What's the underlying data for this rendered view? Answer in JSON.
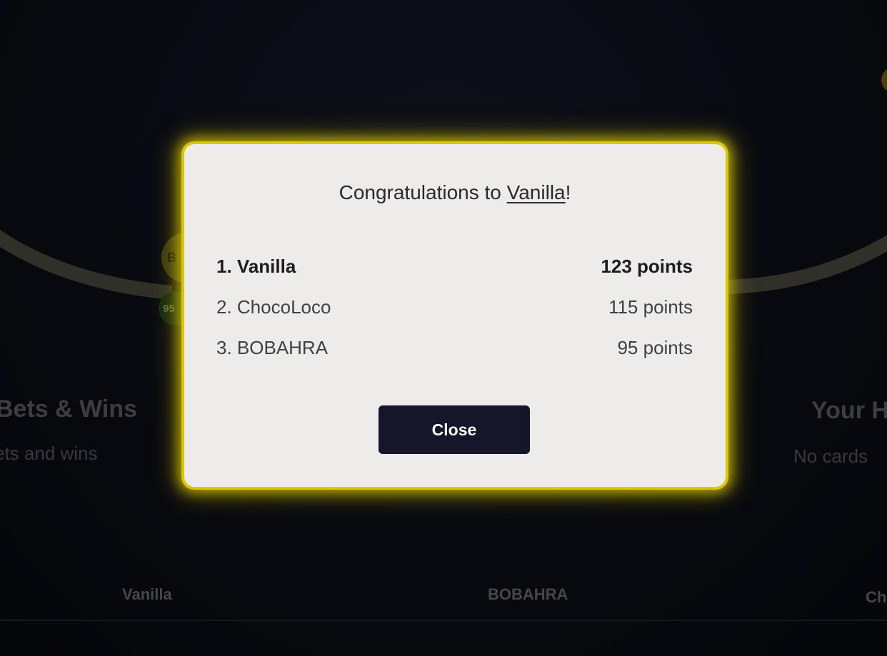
{
  "background": {
    "seat_avatar_text": "B",
    "seat_score_text": "95",
    "bets_title": "Bets & Wins",
    "bets_subtitle": "ets and wins",
    "hand_title": "Your H",
    "hand_subtitle": "No cards",
    "players": [
      "Vanilla",
      "BOBAHRA",
      "Ch"
    ]
  },
  "modal": {
    "title_prefix": "Congratulations to ",
    "winner": "Vanilla",
    "title_suffix": "!",
    "leaderboard": [
      {
        "name": "1. Vanilla",
        "points": "123 points"
      },
      {
        "name": "2. ChocoLoco",
        "points": "115 points"
      },
      {
        "name": "3. BOBAHRA",
        "points": "95 points"
      }
    ],
    "close_label": "Close"
  },
  "colors": {
    "modal_glow": "#d9c800",
    "modal_background": "#eeecea",
    "button_background": "#16162a",
    "page_background": "#0b0d14"
  }
}
